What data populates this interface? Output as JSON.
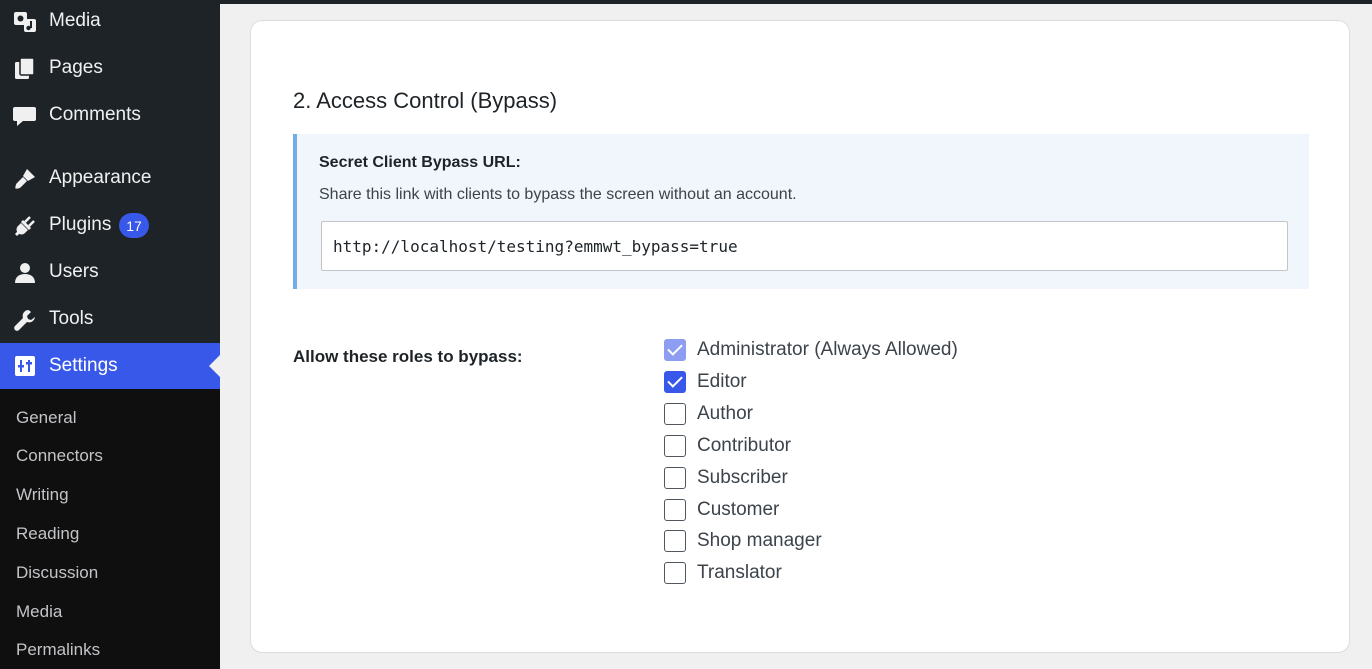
{
  "sidebar": {
    "menu": [
      {
        "label": "Media",
        "icon": "media-icon"
      },
      {
        "label": "Pages",
        "icon": "pages-icon"
      },
      {
        "label": "Comments",
        "icon": "comments-icon"
      },
      {
        "label": "Appearance",
        "icon": "appearance-icon"
      },
      {
        "label": "Plugins",
        "icon": "plugins-icon",
        "badge": "17"
      },
      {
        "label": "Users",
        "icon": "users-icon"
      },
      {
        "label": "Tools",
        "icon": "tools-icon"
      },
      {
        "label": "Settings",
        "icon": "settings-icon",
        "active": true
      }
    ],
    "submenu": [
      "General",
      "Connectors",
      "Writing",
      "Reading",
      "Discussion",
      "Media",
      "Permalinks"
    ]
  },
  "main": {
    "section_title": "2. Access Control (Bypass)",
    "notice": {
      "title": "Secret Client Bypass URL:",
      "description": "Share this link with clients to bypass the screen without an account.",
      "url_value": "http://localhost/testing?emmwt_bypass=true"
    },
    "roles_label": "Allow these roles to bypass:",
    "roles": [
      {
        "label": "Administrator (Always Allowed)",
        "checked": true,
        "disabled": true
      },
      {
        "label": "Editor",
        "checked": true
      },
      {
        "label": "Author",
        "checked": false
      },
      {
        "label": "Contributor",
        "checked": false
      },
      {
        "label": "Subscriber",
        "checked": false
      },
      {
        "label": "Customer",
        "checked": false
      },
      {
        "label": "Shop manager",
        "checked": false
      },
      {
        "label": "Translator",
        "checked": false
      }
    ]
  },
  "colors": {
    "sidebar_bg": "#1d2327",
    "submenu_bg": "#0f0f0f",
    "accent": "#3858e9",
    "notice_bg": "#f0f6fc",
    "notice_border": "#72aee6"
  }
}
